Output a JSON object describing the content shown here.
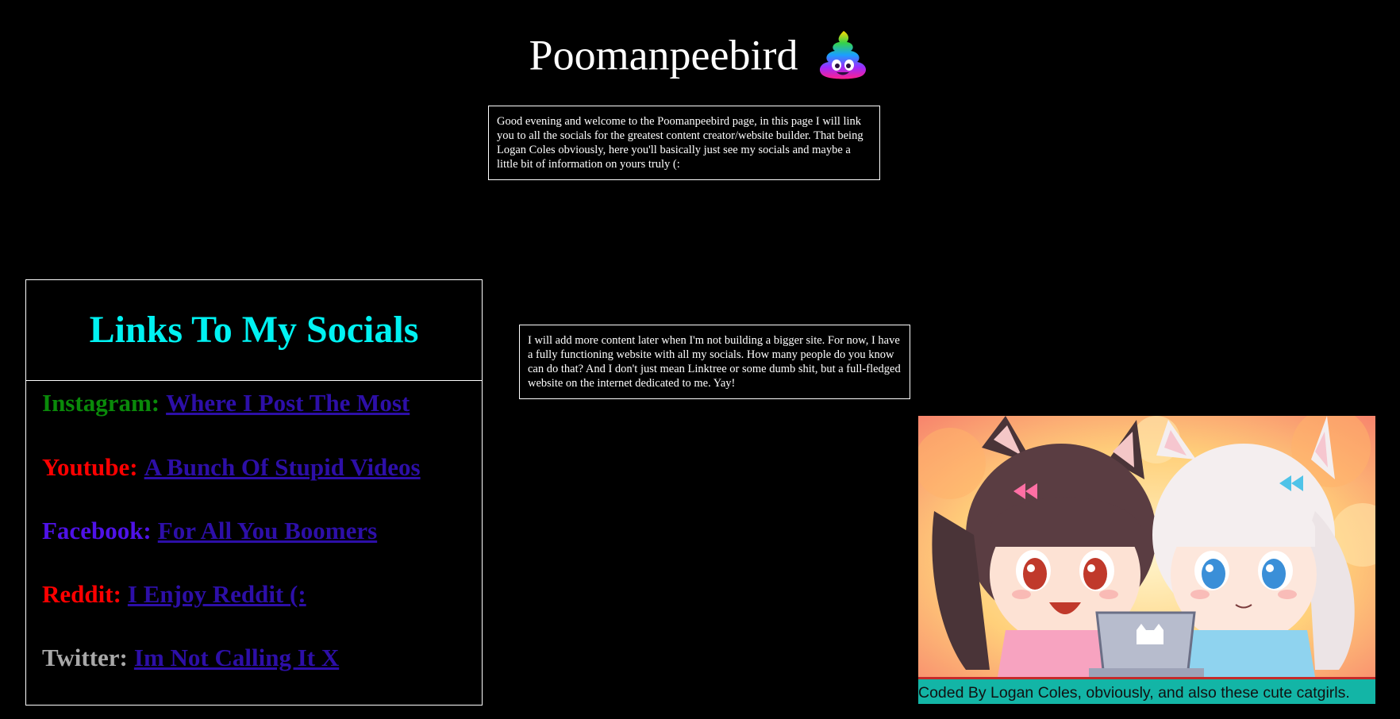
{
  "header": {
    "title": "Poomanpeebird",
    "title_icon": "rainbow-poop-icon"
  },
  "intro": {
    "text": "Good evening and welcome to the Poomanpeebird page, in this page I will link you to all the socials for the greatest content creator/website builder. That being Logan Coles obviously, here you'll basically just see my socials and maybe a little bit of information on yours truly   (:"
  },
  "more_content": {
    "text": "I will add more content later when I'm not building a bigger site. For now, I have a fully functioning website with all my socials. How many people do you know can do that? And I don't just mean Linktree or some dumb shit, but a full-fledged website on the internet dedicated to me. Yay!"
  },
  "socials": {
    "heading": "Links To My Socials",
    "items": [
      {
        "label": "Instagram:",
        "link_text": "Where I Post The Most",
        "label_color": "#0a8a0a"
      },
      {
        "label": "Youtube:",
        "link_text": "A Bunch Of Stupid Videos",
        "label_color": "#ff0000"
      },
      {
        "label": "Facebook:",
        "link_text": "For All You Boomers",
        "label_color": "#4f12e8"
      },
      {
        "label": "Reddit:",
        "link_text": "I Enjoy Reddit (:",
        "label_color": "#ff0000"
      },
      {
        "label": "Twitter:",
        "link_text": "Im Not Calling It X",
        "label_color": "#a8a8a8"
      }
    ],
    "link_color": "#2d0fa8"
  },
  "artwork": {
    "caption": "Coded By Logan Coles, obviously, and also these cute catgirls."
  },
  "colors": {
    "background": "#000000",
    "heading_cyan": "#00f2f2",
    "caption_teal": "#13b5a6"
  }
}
